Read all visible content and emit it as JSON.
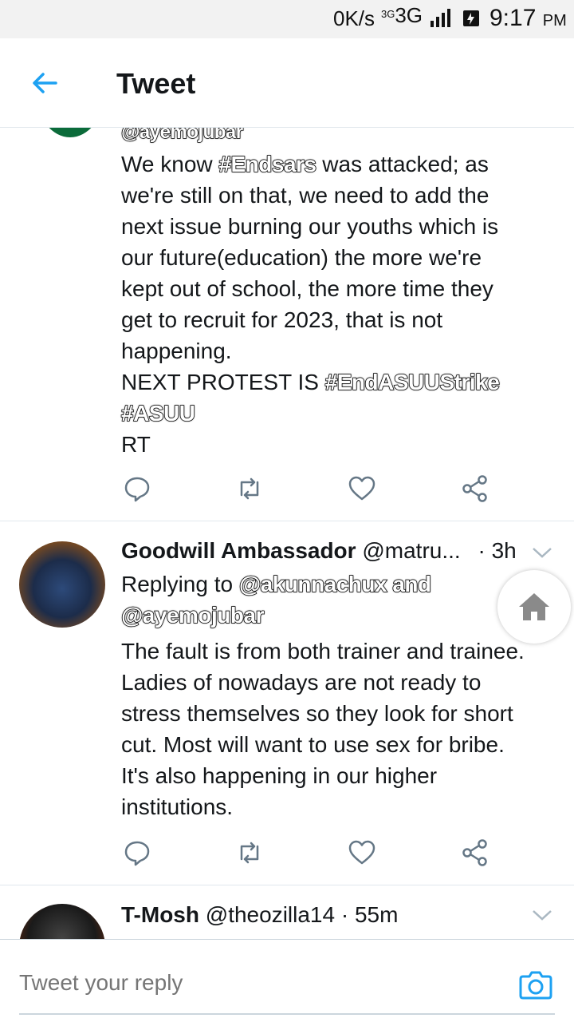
{
  "statusbar": {
    "speed": "0K/s",
    "network": "3G",
    "network_small": "3G",
    "time": "9:17",
    "ampm": "PM"
  },
  "header": {
    "title": "Tweet"
  },
  "tweet1": {
    "handle_partial": "@ayemojubar",
    "line1_pre": "We know ",
    "line1_tag": "#Endsars",
    "line1_post": " was attacked; as",
    "lines": [
      "we're still on that, we need to add the",
      "next issue burning our youths which is",
      "our future(education) the more we're",
      "kept out of school, the more time they",
      "get to recruit for 2023, that is not",
      "happening."
    ],
    "protest_pre": "NEXT PROTEST IS ",
    "protest_tag": "#EndASUUStrike",
    "tag2": "#ASUU",
    "rt": "RT"
  },
  "tweet2": {
    "name": "Goodwill Ambassador",
    "handle": "@matru...",
    "time": "· 3h",
    "replying_pre": "Replying to ",
    "replying_tag1": "@akunnachux and",
    "replying_tag2": "@ayemojubar",
    "lines": [
      "The fault is from both trainer and trainee.",
      "Ladies of nowadays are not ready to",
      "stress themselves so they look for short",
      "cut. Most will want to use sex for bribe.",
      "It's also happening in our higher",
      "institutions."
    ]
  },
  "tweet3": {
    "name": "T-Mosh",
    "handle": "@theozilla14",
    "time": "· 55m"
  },
  "reply": {
    "placeholder": "Tweet your reply"
  },
  "colors": {
    "accent": "#1da1f2",
    "icon_gray": "#657786"
  }
}
